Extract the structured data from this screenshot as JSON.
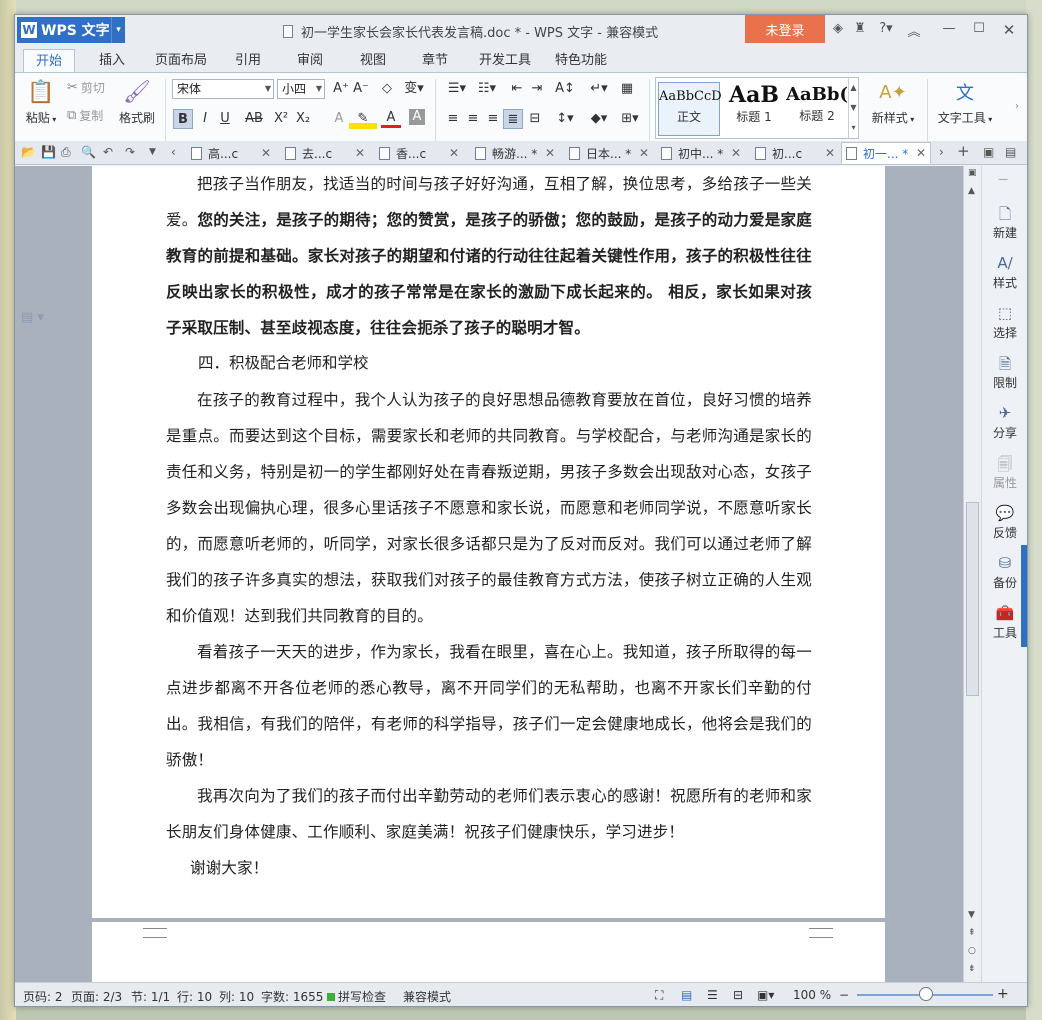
{
  "app": {
    "name": "WPS 文字",
    "window_title": "初一学生家长会家长代表发言稿.doc * - WPS 文字 - 兼容模式",
    "login_button": "未登录"
  },
  "ribbon_tabs": [
    "开始",
    "插入",
    "页面布局",
    "引用",
    "审阅",
    "视图",
    "章节",
    "开发工具",
    "特色功能"
  ],
  "ribbon": {
    "paste": "粘贴",
    "cut": "剪切",
    "copy": "复制",
    "format_painter": "格式刷",
    "font_name": "宋体",
    "font_size": "小四",
    "styles": [
      {
        "sample": "AaBbCcD",
        "label": "正文"
      },
      {
        "sample": "AaB",
        "label": "标题 1"
      },
      {
        "sample": "AaBb(",
        "label": "标题 2"
      }
    ],
    "new_style": "新样式",
    "text_tools": "文字工具"
  },
  "doc_tabs": [
    {
      "label": "高...c"
    },
    {
      "label": "去...c"
    },
    {
      "label": "香...c"
    },
    {
      "label": "畅游... *"
    },
    {
      "label": "日本... *"
    },
    {
      "label": "初中... *"
    },
    {
      "label": "初...c"
    },
    {
      "label": "初一... *"
    }
  ],
  "document": {
    "p1": "把孩子当作朋友，找适当的时间与孩子好好沟通，互相了解，换位思考，多给孩子一些",
    "p1_line2": "关爱。",
    "p1_bold": "您的关注，是孩子的期待；您的赞赏，是孩子的骄傲；您的鼓励，是孩子的动力",
    "p2_bold": "爱是家庭教育的前提和基础。家长对孩子的期望和付诸的行动往往起着关键性作用，孩子的积极性往往反映出家长的积极性，成才的孩子常常是在家长的激励下成长起来的。 相反，家长如果对孩子采取压制、甚至歧视态度，往往会扼杀了孩子的聪明才智。",
    "heading4": "四．积极配合老师和学校",
    "p3": "在孩子的教育过程中，我个人认为孩子的良好思想品德教育要放在首位，良好习惯的培养是重点。而要达到这个目标，需要家长和老师的共同教育。与学校配合，与老师沟通是家长的责任和义务，特别是初一的学生都刚好处在青春叛逆期，男孩子多数会出现敌对心态，女孩子多数会出现偏执心理，很多心里话孩子不愿意和家长说，而愿意和老师同学说，不愿意听家长的，而愿意听老师的，听同学，对家长很多话都只是为了反对而反对。我们可以通过老师了解我们的孩子许多真实的想法，获取我们对孩子的最佳教育方式方法，使孩子树立正确的人生观和价值观！达到我们共同教育的目的。",
    "p4": "看着孩子一天天的进步，作为家长，我看在眼里，喜在心上。我知道，孩子所取得的每一点进步都离不开各位老师的悉心教导，离不开同学们的无私帮助，也离不开家长们辛勤的付出。我相信，有我们的陪伴，有老师的科学指导，孩子们一定会健康地成长，他将会是我们的骄傲！",
    "p5": "我再次向为了我们的孩子而付出辛勤劳动的老师们表示衷心的感谢！祝愿所有的老师和家长朋友们身体健康、工作顺利、家庭美满！祝孩子们健康快乐，学习进步！",
    "p6": "谢谢大家！"
  },
  "side_panel": [
    "新建",
    "样式",
    "选择",
    "限制",
    "分享",
    "属性",
    "反馈",
    "备份",
    "工具"
  ],
  "status": {
    "page_no": "页码: 2",
    "pages": "页面: 2/3",
    "section": "节: 1/1",
    "row": "行: 10",
    "col": "列: 10",
    "words": "字数: 1655",
    "spell": "拼写检查",
    "compat": "兼容模式",
    "zoom": "100 %"
  }
}
